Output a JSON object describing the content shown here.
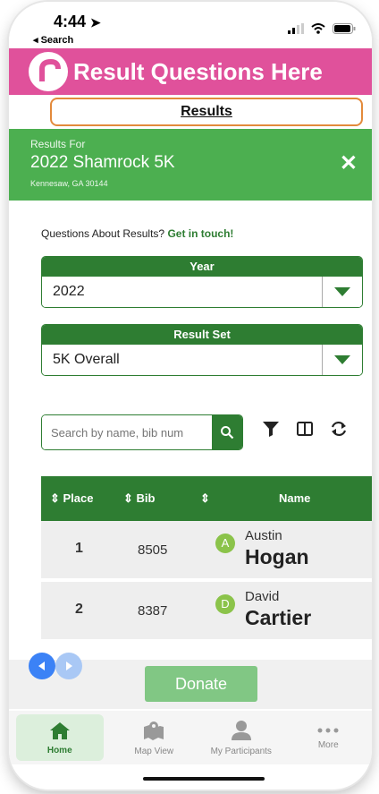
{
  "status_bar": {
    "time": "4:44",
    "back_label": "◂ Search"
  },
  "banner": {
    "title": "Result Questions Here"
  },
  "results_button": {
    "label": "Results"
  },
  "header": {
    "label": "Results For",
    "event": "2022 Shamrock 5K",
    "location": "Kennesaw, GA 30144",
    "close": "✕"
  },
  "questions": {
    "text": "Questions About Results?",
    "link": "Get in touch!"
  },
  "year_select": {
    "caption": "Year",
    "value": "2022"
  },
  "resultset_select": {
    "caption": "Result Set",
    "value": "5K Overall"
  },
  "search": {
    "placeholder": "Search by name, bib num"
  },
  "table": {
    "headers": {
      "place": "Place",
      "bib": "Bib",
      "name": "Name"
    },
    "rows": [
      {
        "place": "1",
        "bib": "8505",
        "initial": "A",
        "first": "Austin",
        "last": "Hogan"
      },
      {
        "place": "2",
        "bib": "8387",
        "initial": "D",
        "first": "David",
        "last": "Cartier"
      }
    ]
  },
  "donate": {
    "label": "Donate"
  },
  "tabs": [
    {
      "label": "Home",
      "icon": "home-icon",
      "active": true
    },
    {
      "label": "Map View",
      "icon": "map-icon",
      "active": false
    },
    {
      "label": "My Participants",
      "icon": "person-icon",
      "active": false
    },
    {
      "label": "More",
      "icon": "more-icon",
      "active": false
    }
  ],
  "colors": {
    "brand_pink": "#e0519b",
    "green": "#2e7d32",
    "light_green": "#4caf50",
    "accent_orange": "#e38a3b"
  }
}
